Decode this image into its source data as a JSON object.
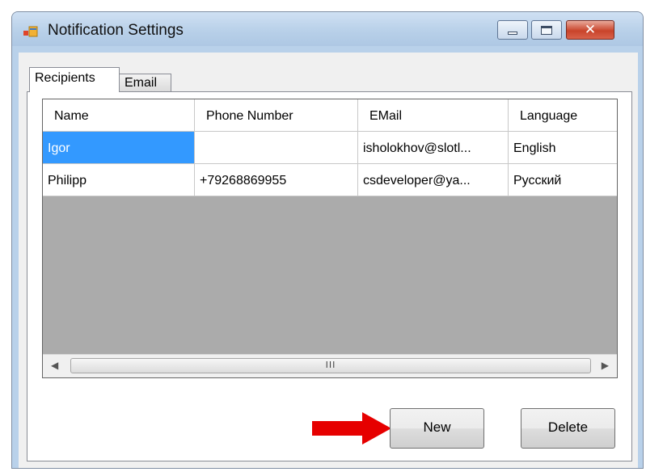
{
  "window": {
    "title": "Notification Settings"
  },
  "tabs": [
    {
      "label": "Recipients"
    },
    {
      "label": "Email"
    }
  ],
  "grid": {
    "columns": [
      "Name",
      "Phone Number",
      "EMail",
      "Language"
    ],
    "rows": [
      {
        "name": "Igor",
        "phone": "",
        "email": "isholokhov@slotl...",
        "language": "English"
      },
      {
        "name": "Philipp",
        "phone": "+79268869955",
        "email": "csdeveloper@ya...",
        "language": "Русский"
      }
    ],
    "scroll_thumb": "III"
  },
  "buttons": {
    "new": "New",
    "delete": "Delete"
  },
  "colors": {
    "selection": "#3399ff",
    "annotation_arrow": "#e60000",
    "grid_background": "#ababab"
  }
}
